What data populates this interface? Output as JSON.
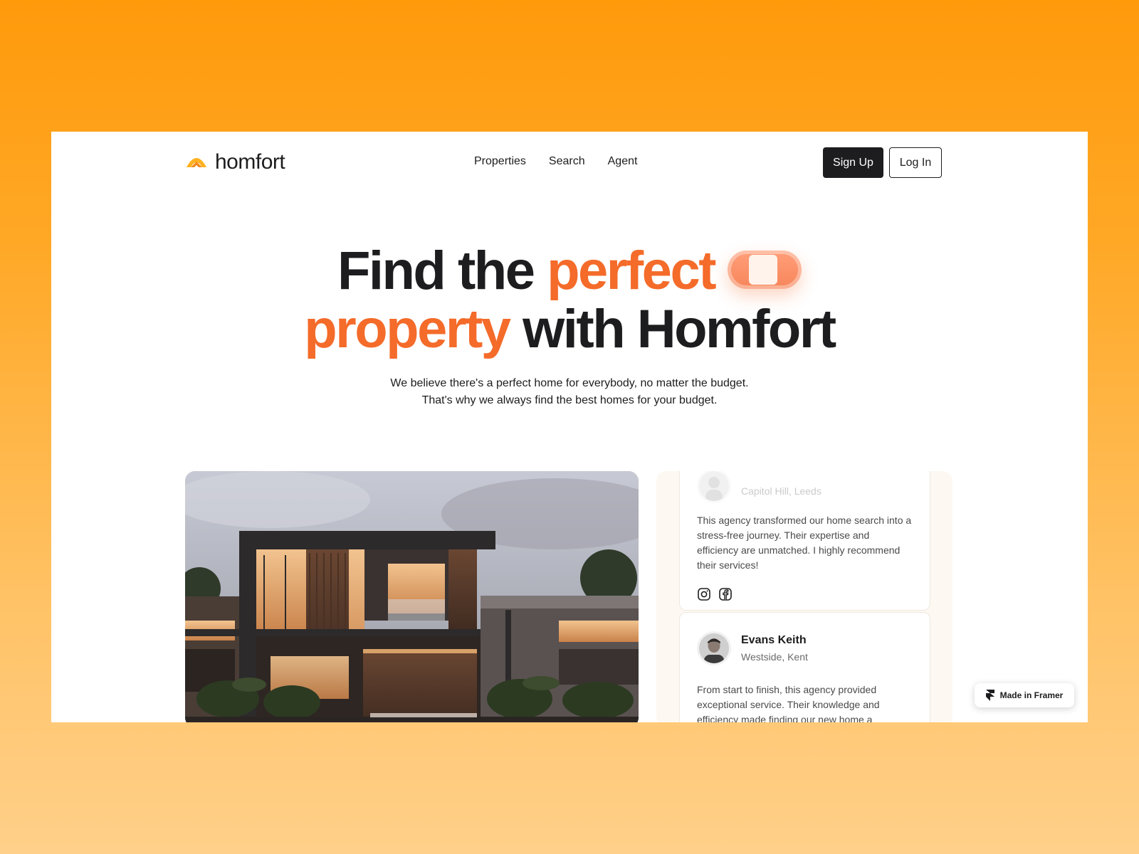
{
  "brand": {
    "name": "homfort",
    "accent_color": "#f46b2a",
    "logo_color": "#ffb11f"
  },
  "nav": {
    "links": [
      "Properties",
      "Search",
      "Agent"
    ],
    "signup_label": "Sign Up",
    "login_label": "Log In"
  },
  "hero": {
    "title_part1": "Find the",
    "title_accent1": "perfect",
    "title_accent2": "property",
    "title_part2": "with Homfort",
    "subtitle_line1": "We believe there's a perfect home for everybody, no matter the budget.",
    "subtitle_line2": "That's why we always find the best homes for your budget."
  },
  "testimonials": [
    {
      "location": "Capitol Hill, Leeds",
      "quote": "This agency transformed our home search into a stress-free journey. Their expertise and efficiency are unmatched. I highly recommend their services!",
      "socials": [
        "instagram-icon",
        "facebook-icon"
      ]
    },
    {
      "name": "Evans Keith",
      "location": "Westside, Kent",
      "quote": "From start to finish, this agency provided exceptional service. Their knowledge and efficiency made finding our new home a"
    }
  ],
  "badge": {
    "label": "Made in Framer"
  }
}
